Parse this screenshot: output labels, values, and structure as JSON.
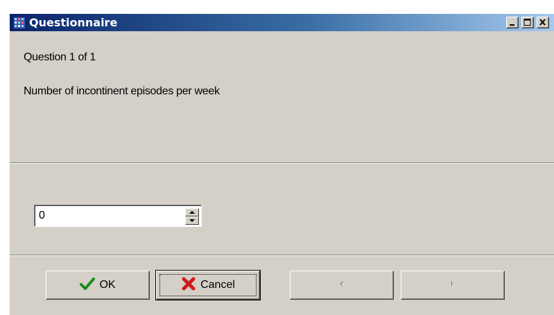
{
  "window": {
    "title": "Questionnaire",
    "app_icon": "grid-app-icon",
    "controls": {
      "minimize_icon": "minimize-icon",
      "maximize_icon": "maximize-icon",
      "close_icon": "close-icon"
    }
  },
  "question": {
    "counter": "Question 1 of 1",
    "text": "Number of incontinent episodes per week"
  },
  "answer": {
    "value": "0",
    "spinner_up_icon": "spin-up-icon",
    "spinner_down_icon": "spin-down-icon"
  },
  "buttons": {
    "ok_label": "OK",
    "ok_icon": "checkmark-icon",
    "cancel_label": "Cancel",
    "cancel_icon": "red-x-icon",
    "prev_icon": "arrow-left-icon",
    "next_icon": "arrow-right-icon"
  },
  "colors": {
    "face": "#d4d0c8",
    "title_start": "#0a246a",
    "title_end": "#a6caf0",
    "ok_check": "#1a8a1a",
    "cancel_x": "#d11a1a",
    "disabled": "#808080"
  }
}
